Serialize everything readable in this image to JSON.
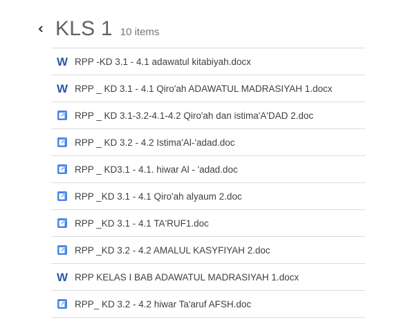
{
  "folder": {
    "title": "KLS 1",
    "count_label": "10 items"
  },
  "colors": {
    "word_blue": "#2a5ba8",
    "doc_blue": "#4a86e8"
  },
  "files": [
    {
      "name": "RPP -KD 3.1 - 4.1 adawatul kitabiyah.docx",
      "icon": "word-icon"
    },
    {
      "name": "RPP _ KD 3.1 - 4.1 Qiro'ah ADAWATUL MADRASIYAH 1.docx",
      "icon": "word-icon"
    },
    {
      "name": "RPP _ KD 3.1-3.2-4.1-4.2 Qiro'ah dan istima'A'DAD 2.doc",
      "icon": "doc-edit-icon"
    },
    {
      "name": "RPP _ KD 3.2 - 4.2 Istima'Al-'adad.doc",
      "icon": "doc-edit-icon"
    },
    {
      "name": "RPP _ KD3.1 - 4.1. hiwar Al - 'adad.doc",
      "icon": "doc-edit-icon"
    },
    {
      "name": "RPP _KD 3.1 - 4.1 Qiro'ah alyaum 2.doc",
      "icon": "doc-edit-icon"
    },
    {
      "name": "RPP _KD 3.1 - 4.1 TA'RUF1.doc",
      "icon": "doc-edit-icon"
    },
    {
      "name": "RPP _KD 3.2 - 4.2 AMALUL KASYFIYAH 2.doc",
      "icon": "doc-edit-icon"
    },
    {
      "name": "RPP KELAS I BAB ADAWATUL MADRASIYAH 1.docx",
      "icon": "word-icon"
    },
    {
      "name": "RPP_ KD 3.2 - 4.2 hiwar Ta'aruf AFSH.doc",
      "icon": "doc-edit-icon"
    }
  ]
}
